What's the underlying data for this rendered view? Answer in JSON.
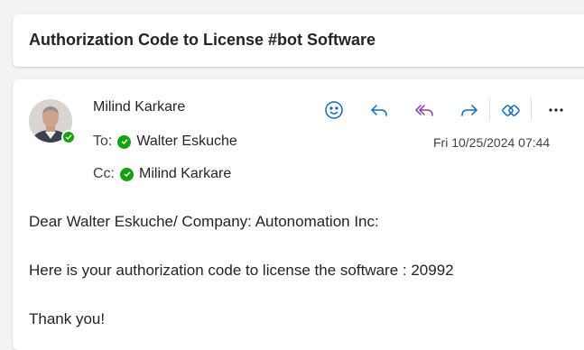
{
  "subject": "Authorization Code to License #bot Software",
  "message": {
    "sender": "Milind Karkare",
    "to_prefix": "To:",
    "to": "Walter Eskuche",
    "cc_prefix": "Cc:",
    "cc": "Milind Karkare",
    "timestamp": "Fri 10/25/2024 07:44",
    "toolbar": [
      "emoji-reaction-icon",
      "reply-icon",
      "reply-all-icon",
      "forward-icon",
      "loop-icon",
      "more-icon"
    ],
    "body": {
      "greeting": "Dear Walter Eskuche/ Company: Autonomation Inc:",
      "line1": "Here is your authorization code to license the software : 20992",
      "closing": "Thank you!"
    }
  },
  "colors": {
    "accent": "#0f6cbd",
    "reply_all": "#8a3aa8",
    "presence": "#13a10e"
  }
}
